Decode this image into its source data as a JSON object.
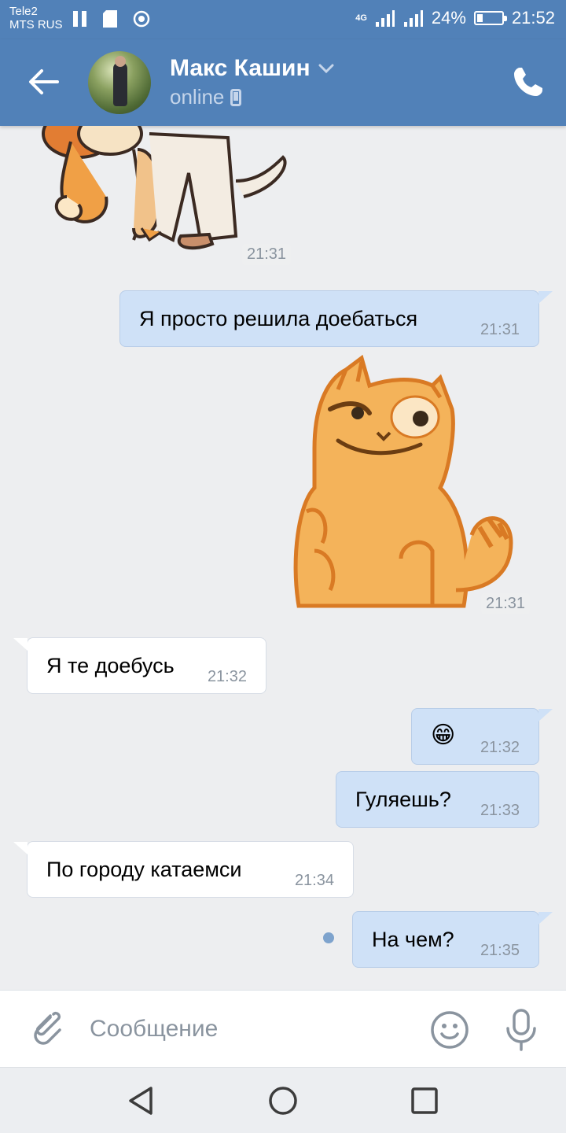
{
  "status_bar": {
    "carrier_line1": "Tele2",
    "carrier_line2": "MTS RUS",
    "network": "4G",
    "battery_text": "24%",
    "battery_level": 0.24,
    "time": "21:52"
  },
  "header": {
    "contact_name": "Макс Кашин",
    "status": "online"
  },
  "messages": [
    {
      "direction": "in",
      "type": "sticker",
      "sticker": "boy-and-fox-sticker",
      "time": "21:31"
    },
    {
      "direction": "out",
      "type": "text",
      "text": "Я просто решила доебаться",
      "time": "21:31"
    },
    {
      "direction": "out",
      "type": "sticker",
      "sticker": "smirking-cat-sticker",
      "time": "21:31"
    },
    {
      "direction": "in",
      "type": "text",
      "text": "Я те доебусь",
      "time": "21:32"
    },
    {
      "direction": "out",
      "type": "emoji",
      "text": "😁",
      "time": "21:32"
    },
    {
      "direction": "out",
      "type": "text",
      "text": "Гуляешь?",
      "time": "21:33"
    },
    {
      "direction": "in",
      "type": "text",
      "text": "По городу катаемси",
      "time": "21:34"
    },
    {
      "direction": "out",
      "type": "text",
      "text": "На чем?",
      "time": "21:35",
      "unread": true
    }
  ],
  "input": {
    "placeholder": "Сообщение",
    "value": ""
  },
  "icons": {
    "back": "arrow-left-icon",
    "call": "phone-icon",
    "attach": "paperclip-icon",
    "emoji": "smile-icon",
    "mic": "microphone-icon"
  },
  "colors": {
    "header": "#5181b8",
    "outgoing_bubble": "#cfe1f7",
    "incoming_bubble": "#ffffff",
    "background": "#edeef0"
  }
}
